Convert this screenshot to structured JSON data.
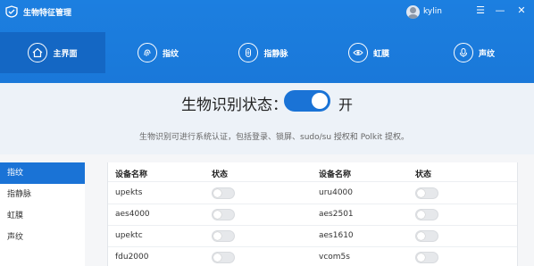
{
  "app": {
    "title": "生物特征管理",
    "username": "kylin"
  },
  "window_controls": {
    "menu": "☰",
    "minimize": "—",
    "close": "✕"
  },
  "tabs": [
    {
      "label": "主界面",
      "icon": "home-icon"
    },
    {
      "label": "指纹",
      "icon": "fingerprint-icon"
    },
    {
      "label": "指静脉",
      "icon": "finger-vein-icon"
    },
    {
      "label": "虹膜",
      "icon": "iris-icon"
    },
    {
      "label": "声纹",
      "icon": "voiceprint-icon"
    }
  ],
  "status": {
    "title": "生物识别状态：",
    "state": "开",
    "enabled": true,
    "description": "生物识别可进行系统认证，包括登录、锁屏、sudo/su 授权和 Polkit 提权。"
  },
  "sidebar": {
    "items": [
      {
        "label": "指纹",
        "active": true
      },
      {
        "label": "指静脉",
        "active": false
      },
      {
        "label": "虹膜",
        "active": false
      },
      {
        "label": "声纹",
        "active": false
      }
    ]
  },
  "table": {
    "headers": {
      "device": "设备名称",
      "status": "状态"
    },
    "left": [
      {
        "name": "upekts",
        "enabled": false
      },
      {
        "name": "aes4000",
        "enabled": false
      },
      {
        "name": "upektc",
        "enabled": false
      },
      {
        "name": "fdu2000",
        "enabled": false
      }
    ],
    "right": [
      {
        "name": "uru4000",
        "enabled": false
      },
      {
        "name": "aes2501",
        "enabled": false
      },
      {
        "name": "aes1610",
        "enabled": false
      },
      {
        "name": "vcom5s",
        "enabled": false
      }
    ]
  },
  "colors": {
    "accent": "#1a73d6",
    "header": "#1c7fe0",
    "tab_active": "#1467c4"
  }
}
